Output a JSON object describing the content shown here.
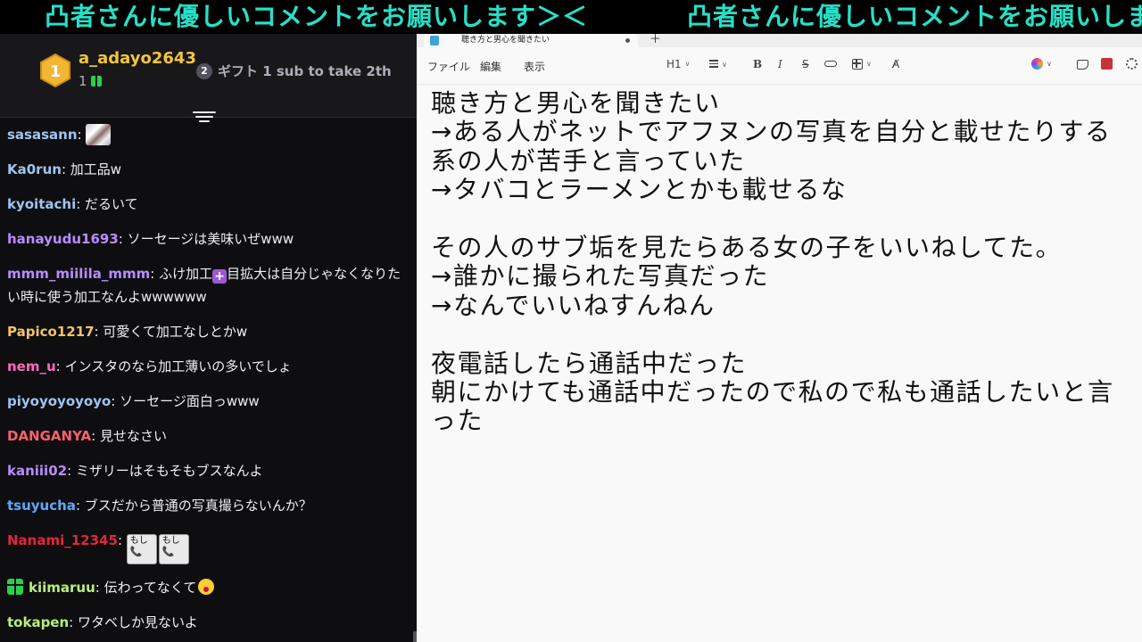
{
  "banner": {
    "text_1": "凸者さんに優しいコメントをお願いします＞＜",
    "text_2": "凸者さんに優しいコメントをお願いします＞＜"
  },
  "chat": {
    "top_gifter": {
      "rank": "1",
      "name": "a_adayo2643",
      "count": "1"
    },
    "second": {
      "rank": "2",
      "text": "ギフト 1 sub to take 2th"
    },
    "messages": [
      {
        "user": "sasasann",
        "color": "#9ec5f0",
        "text": "",
        "emote": "sasa"
      },
      {
        "user": "Ka0run",
        "color": "#9ec5f0",
        "text": "加工品w"
      },
      {
        "user": "kyoitachi",
        "color": "#9ec5f0",
        "text": "だるいて"
      },
      {
        "user": "hanayudu1693",
        "color": "#b98bff",
        "text": "ソーセージは美味いぜwww"
      },
      {
        "user": "mmm_miilila_mmm",
        "color": "#b98bff",
        "text_a": "ふけ加工",
        "text_b": "目拡大は自分じゃなくなりたい時に使う加工なんよwwwwww"
      },
      {
        "user": "Papico1217",
        "color": "#f7c26b",
        "text": "可愛くて加工なしとかw"
      },
      {
        "user": "nem_u",
        "color": "#ff6bb5",
        "text": "インスタのなら加工薄いの多いでしょ"
      },
      {
        "user": "piyoyoyoyoyo",
        "color": "#9ec5f0",
        "text": "ソーセージ面白っwww"
      },
      {
        "user": "DANGANYA",
        "color": "#ff5f6d",
        "text": "見せなさい"
      },
      {
        "user": "kaniii02",
        "color": "#b98bff",
        "text": "ミザリーはそもそもブスなんよ"
      },
      {
        "user": "tsuyucha",
        "color": "#5fa8ff",
        "text": "ブスだから普通の写真撮らないんか？"
      },
      {
        "user": "Nanami_12345",
        "color": "#e3263a",
        "text": "",
        "emote": "moshi",
        "emote_text": "もし"
      },
      {
        "user": "kiimaruu",
        "color": "#b8f07a",
        "text": "伝わってなくて"
      },
      {
        "user": "tokapen",
        "color": "#b8f07a",
        "text": "ワタベしか見ないよ"
      }
    ]
  },
  "notepad": {
    "tab_title": "聴き方と男心を聞きたい",
    "menu": [
      "ファイル",
      "編集",
      "表示"
    ],
    "toolbar": {
      "heading": "H1",
      "bold": "B",
      "italic": "I",
      "strike": "S"
    },
    "content": [
      "聴き方と男心を聞きたい",
      "→ある人がネットでアフヌンの写真を自分と載せたりする系の人が苦手と言っていた",
      "→タバコとラーメンとかも載せるな",
      "",
      "その人のサブ垢を見たらある女の子をいいねしてた。",
      "→誰かに撮られた写真だった",
      "→なんでいいねすんねん",
      "",
      "夜電話したら通話中だった",
      "朝にかけても通話中だったので私ので私も通話したいと言った"
    ]
  },
  "colors": {
    "banner": "#27e0c8",
    "chat_bg": "#0e0e10",
    "gold": "#f2c541"
  }
}
